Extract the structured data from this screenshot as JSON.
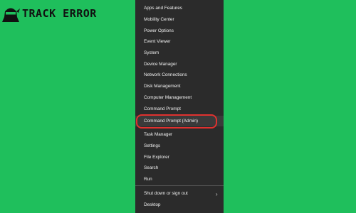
{
  "logo": {
    "text": "TRACK ERROR",
    "icon": "ninja-logo-icon"
  },
  "menu": {
    "items": [
      {
        "label": "Apps and Features"
      },
      {
        "label": "Mobility Center"
      },
      {
        "label": "Power Options"
      },
      {
        "label": "Event Viewer"
      },
      {
        "label": "System"
      },
      {
        "label": "Device Manager"
      },
      {
        "label": "Network Connections"
      },
      {
        "label": "Disk Management"
      },
      {
        "label": "Computer Management"
      },
      {
        "label": "Command Prompt"
      },
      {
        "label": "Command Prompt (Admin)",
        "highlighted": true
      },
      {
        "label": "Task Manager"
      },
      {
        "label": "Settings"
      },
      {
        "label": "File Explorer"
      },
      {
        "label": "Search"
      },
      {
        "label": "Run"
      },
      {
        "label": "Shut down or sign out",
        "submenu_icon": "chevron-right-icon"
      },
      {
        "label": "Desktop"
      }
    ]
  },
  "colors": {
    "background": "#1fbf5c",
    "menu_background": "#2b2b2b",
    "menu_text": "#f2f2f2",
    "highlight_ring": "#e0312f"
  }
}
